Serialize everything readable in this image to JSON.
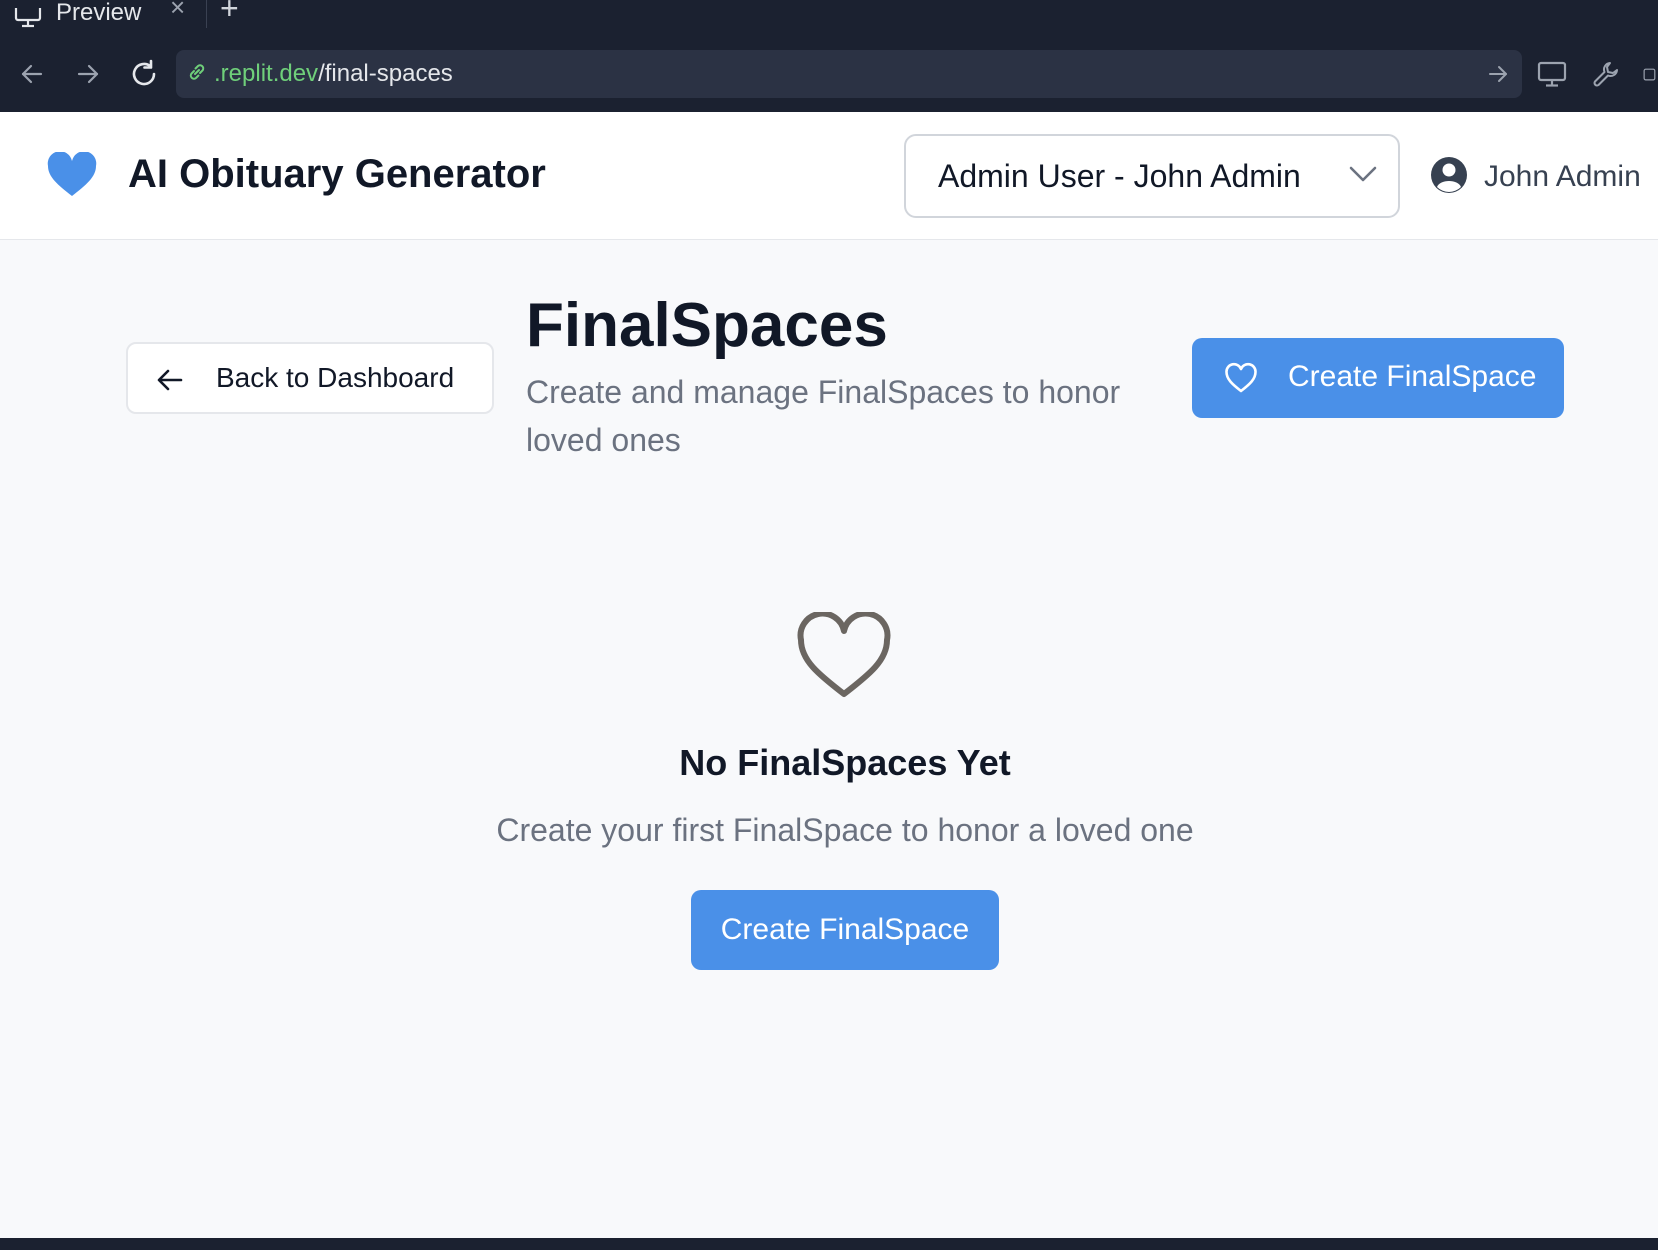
{
  "browser": {
    "tab_title": "Preview",
    "tab_close": "×",
    "new_tab": "+",
    "url_host": ".replit.dev",
    "url_path": "/final-spaces"
  },
  "app": {
    "title": "AI Obituary Generator",
    "role_selector": "Admin User - John Admin",
    "user_name": "John Admin",
    "accent_color": "#4a90e8"
  },
  "main": {
    "back_label": "Back to Dashboard",
    "title": "FinalSpaces",
    "subtitle": "Create and manage FinalSpaces to honor loved ones",
    "create_label": "Create FinalSpace"
  },
  "empty_state": {
    "title": "No FinalSpaces Yet",
    "description": "Create your first FinalSpace to honor a loved one",
    "create_label": "Create FinalSpace"
  },
  "icons": {
    "tab": "monitor-icon",
    "back": "arrow-left-icon",
    "forward": "arrow-right-icon",
    "reload": "reload-icon",
    "link": "link-icon",
    "go": "arrow-right-icon",
    "devices": "monitor-icon",
    "tools": "wrench-icon",
    "external": "external-icon",
    "brand": "heart-icon",
    "avatar": "user-circle-icon",
    "empty": "heart-outline-icon"
  }
}
